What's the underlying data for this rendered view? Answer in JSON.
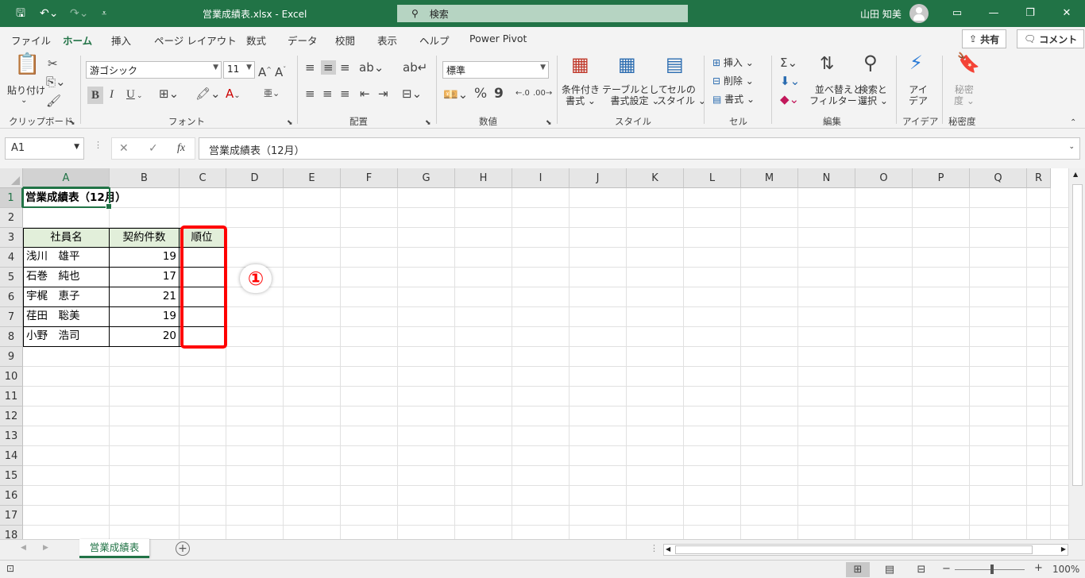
{
  "app": {
    "title": "営業成績表.xlsx  -  Excel",
    "search_label": "検索",
    "user_name": "山田 知美",
    "undo_icon": "undo-icon",
    "redo_icon": "redo-icon"
  },
  "menu": [
    "ファイル",
    "ホーム",
    "挿入",
    "ページ レイアウト",
    "数式",
    "データ",
    "校閲",
    "表示",
    "ヘルプ",
    "Power Pivot"
  ],
  "menu_active": "ホーム",
  "share": {
    "label": "共有",
    "comment_label": "コメント"
  },
  "ribbon": {
    "clipboard": {
      "paste": "貼り付け",
      "paste_arrow": "⌄",
      "group": "クリップボード"
    },
    "font": {
      "name": "游ゴシック",
      "size": "11",
      "grow": "A^",
      "shrink": "Aˇ",
      "bold": "B",
      "italic": "I",
      "underline": "U",
      "group": "フォント"
    },
    "alignment": {
      "group": "配置"
    },
    "number": {
      "format": "標準",
      "percent": "%",
      "comma": "9",
      "group": "数値"
    },
    "styles": {
      "conditional": "条件付き\n書式 ⌄",
      "table": "テーブルとして\n書式設定 ⌄",
      "cell_styles": "セルの\nスタイル ⌄",
      "group": "スタイル"
    },
    "cells": {
      "insert": "挿入",
      "delete": "削除",
      "format": "書式",
      "group": "セル"
    },
    "editing": {
      "sort": "並べ替えと\nフィルター ⌄",
      "find": "検索と\n選択 ⌄",
      "group": "編集"
    },
    "ideas": {
      "label": "アイ\nデア",
      "group": "アイデア"
    },
    "sensitivity": {
      "label": "秘密\n度 ⌄",
      "group": "秘密度"
    }
  },
  "formula_bar": {
    "name_box": "A1",
    "fx": "fx",
    "formula": "営業成績表（12月）"
  },
  "columns": [
    "A",
    "B",
    "C",
    "D",
    "E",
    "F",
    "G",
    "H",
    "I",
    "J",
    "K",
    "L",
    "M",
    "N",
    "O",
    "P",
    "Q",
    "R"
  ],
  "rows": [
    "1",
    "2",
    "3",
    "4",
    "5",
    "6",
    "7",
    "8",
    "9",
    "10",
    "11",
    "12",
    "13",
    "14",
    "15",
    "16",
    "17",
    "18"
  ],
  "sheet": {
    "title": "営業成績表（12月）",
    "headers": [
      "社員名",
      "契約件数",
      "順位"
    ],
    "records": [
      {
        "name": "浅川　雄平",
        "count": "19"
      },
      {
        "name": "石巻　純也",
        "count": "17"
      },
      {
        "name": "宇梶　恵子",
        "count": "21"
      },
      {
        "name": "荏田　聡美",
        "count": "19"
      },
      {
        "name": "小野　浩司",
        "count": "20"
      }
    ]
  },
  "annotation": {
    "marker": "①",
    "highlight_color": "#ff0000"
  },
  "sheet_tabs": [
    {
      "label": "営業成績表",
      "active": true
    }
  ],
  "status": {
    "zoom": "100%"
  },
  "colors": {
    "accent": "#217346",
    "header_fill": "#e2efda"
  }
}
